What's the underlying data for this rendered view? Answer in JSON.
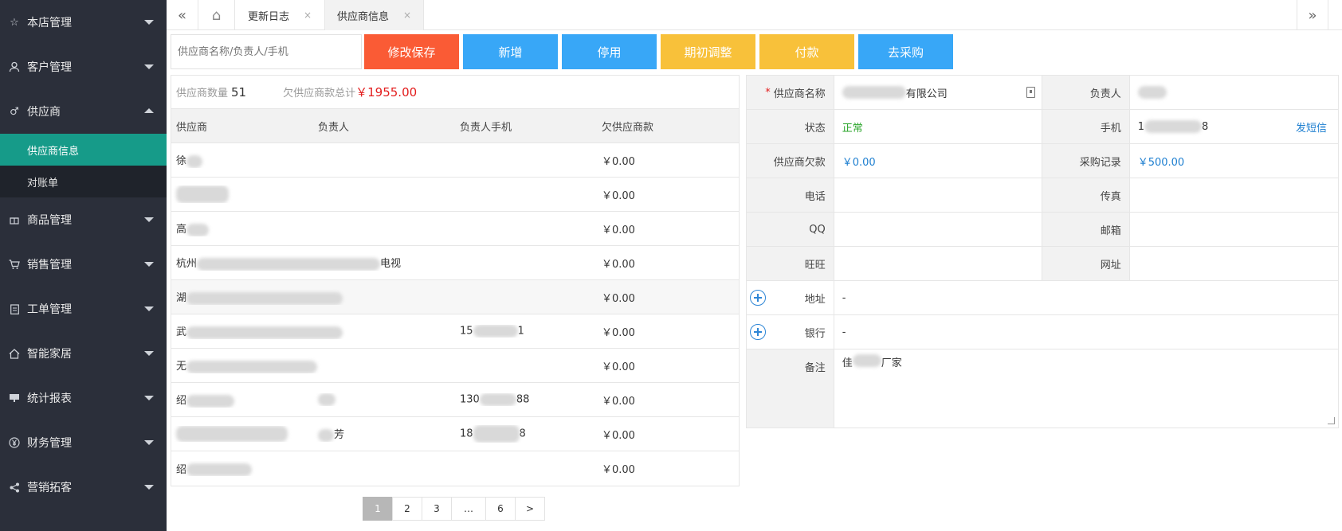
{
  "sidebar": {
    "items": [
      {
        "label": "本店管理",
        "icon": "star-icon"
      },
      {
        "label": "客户管理",
        "icon": "user-icon"
      },
      {
        "label": "供应商",
        "icon": "male-icon"
      },
      {
        "label": "商品管理",
        "icon": "gift-icon"
      },
      {
        "label": "销售管理",
        "icon": "cart-icon"
      },
      {
        "label": "工单管理",
        "icon": "clipboard-icon"
      },
      {
        "label": "智能家居",
        "icon": "home-icon"
      },
      {
        "label": "统计报表",
        "icon": "monitor-icon"
      },
      {
        "label": "财务管理",
        "icon": "yen-icon"
      },
      {
        "label": "营销拓客",
        "icon": "share-icon"
      }
    ],
    "sub_items": [
      "供应商信息",
      "对账单"
    ]
  },
  "tabs": {
    "back_icon": "«",
    "forward_icon": "»",
    "home_icon": "⌂",
    "changelog": "更新日志",
    "supplier_info": "供应商信息",
    "close": "×"
  },
  "toolbar": {
    "search_placeholder": "供应商名称/负责人/手机",
    "save": "修改保存",
    "add": "新增",
    "disable": "停用",
    "initial_adjust": "期初调整",
    "pay": "付款",
    "purchase": "去采购",
    "colors": {
      "save": "#fa5b35",
      "add": "#38a7f7",
      "disable": "#38a7f7",
      "initial_adjust": "#f8c13a",
      "pay": "#f8c13a",
      "purchase": "#38a7f7"
    }
  },
  "summary": {
    "count_label": "供应商数量",
    "count": "51",
    "owed_label": "欠供应商款总计",
    "owed": "￥1955.00"
  },
  "table": {
    "headers": [
      "供应商",
      "负责人",
      "负责人手机",
      "欠供应商款"
    ],
    "rows": [
      {
        "supplier": "徐",
        "owner": "",
        "phone": "",
        "owed": "￥0.00"
      },
      {
        "supplier": "",
        "owner": "",
        "phone": "",
        "owed": "￥0.00"
      },
      {
        "supplier": "高",
        "owner": "",
        "phone": "",
        "owed": "￥0.00"
      },
      {
        "supplier": "杭州",
        "supplier_tail": "电视",
        "owner": "",
        "phone": "",
        "owed": "￥0.00"
      },
      {
        "supplier": "湖",
        "owner": "",
        "phone": "",
        "owed": "￥0.00"
      },
      {
        "supplier": "武",
        "owner": "",
        "phone": "15",
        "phone_tail": "1",
        "owed": "￥0.00"
      },
      {
        "supplier": "无",
        "owner": "",
        "phone": "",
        "owed": "￥0.00"
      },
      {
        "supplier": "绍",
        "owner": "",
        "phone": "130",
        "phone_tail": "88",
        "owed": "￥0.00"
      },
      {
        "supplier": "",
        "owner": "",
        "owner_tail": "芳",
        "phone": "18",
        "phone_tail": "8",
        "owed": "￥0.00"
      },
      {
        "supplier": "绍",
        "owner": "",
        "phone": "",
        "owed": "￥0.00"
      }
    ]
  },
  "pagination": [
    "1",
    "2",
    "3",
    "…",
    "6",
    ">"
  ],
  "detail": {
    "name_label": "供应商名称",
    "name_tail": "有限公司",
    "owner_label": "负责人",
    "status_label": "状态",
    "status": "正常",
    "mobile_label": "手机",
    "mobile_head": "1",
    "mobile_tail": "8",
    "sms_link": "发短信",
    "owed_label": "供应商欠款",
    "owed": "￥0.00",
    "purchase_label": "采购记录",
    "purchase": "￥500.00",
    "phone_label": "电话",
    "fax_label": "传真",
    "qq_label": "QQ",
    "email_label": "邮箱",
    "wangwang_label": "旺旺",
    "website_label": "网址",
    "address_label": "地址",
    "address": "-",
    "bank_label": "银行",
    "bank": "-",
    "notes_label": "备注",
    "notes_head": "佳",
    "notes_tail": "厂家"
  }
}
